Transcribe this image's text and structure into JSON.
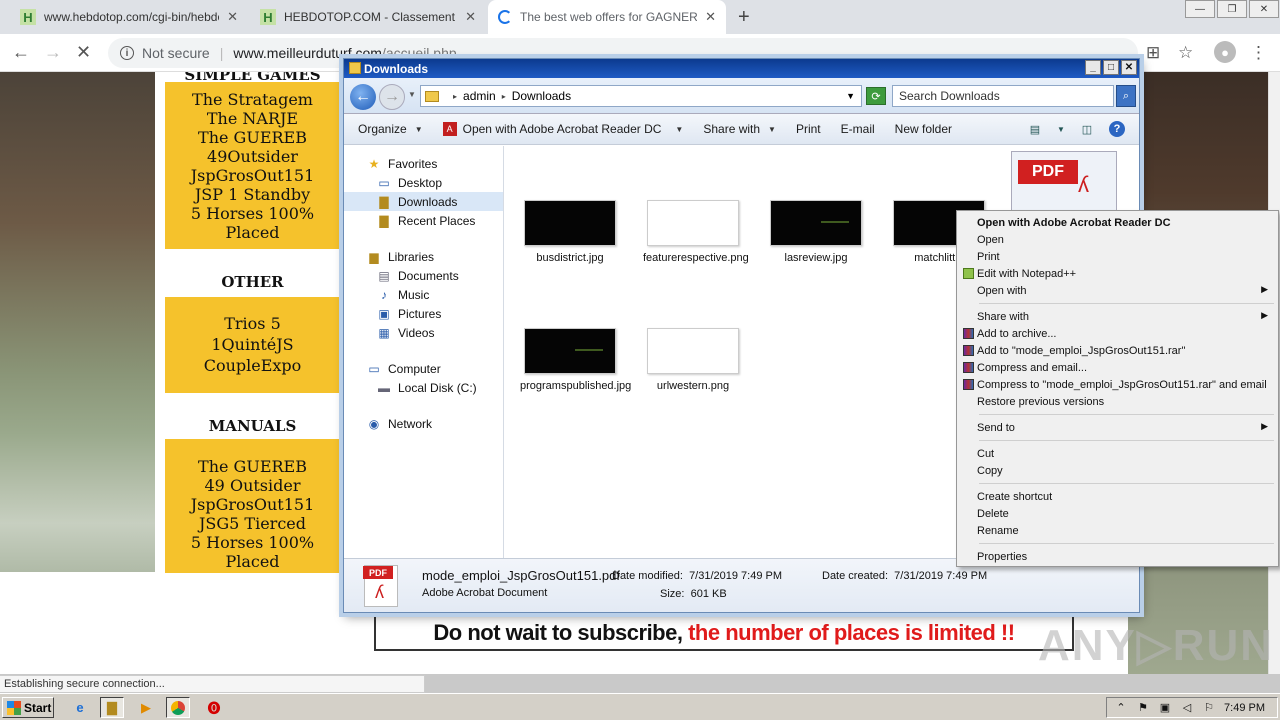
{
  "browser": {
    "tabs": [
      {
        "title": "www.hebdotop.com/cgi-bin/hebdot",
        "favicon": "hebdotop-icon",
        "active": false
      },
      {
        "title": "HEBDOTOP.COM - Classement de sit",
        "favicon": "hebdotop-icon",
        "active": false
      },
      {
        "title": "The best web offers for GAGNER AU",
        "favicon": "loading-spinner-icon",
        "active": true
      }
    ],
    "favicon_letter": "H",
    "new_tab": "+",
    "close_glyph": "✕",
    "window_controls": [
      "—",
      "❐",
      "✕"
    ],
    "address": {
      "security": "Not secure",
      "host": "www.meilleurduturf.com",
      "path": "/accueil.php"
    },
    "status": "Establishing secure connection..."
  },
  "page": {
    "sections": [
      {
        "heading": "SIMPLE GAMES",
        "items": [
          "The Stratagem",
          "The NARJE",
          "The GUEREB",
          "49Outsider",
          "JspGrosOut151",
          "JSP 1 Standby",
          "5 Horses 100% Placed"
        ]
      },
      {
        "heading": "OTHER",
        "items": [
          "Trios 5",
          "1QuintéJS",
          "CoupleExpo"
        ]
      },
      {
        "heading": "MANUALS",
        "items": [
          "The GUEREB",
          "49 Outsider",
          "JspGrosOut151",
          "JSG5 Tierced",
          "5 Horses 100% Placed"
        ]
      }
    ],
    "subscribe": {
      "part1": "Do not wait to subscribe, ",
      "part2": "the number of places is limited !!"
    },
    "watermark": "ANY▷RUN",
    "colors": {
      "accent_box": "#f5c22c",
      "limited_red": "#e01b1b"
    }
  },
  "explorer": {
    "title": "Downloads",
    "title_controls": [
      "_",
      "□",
      "✕"
    ],
    "breadcrumb": [
      "admin",
      "Downloads"
    ],
    "search_placeholder": "Search Downloads",
    "commands": {
      "organize": "Organize",
      "open_with": "Open with Adobe Acrobat Reader DC",
      "share_with": "Share with",
      "print": "Print",
      "email": "E-mail",
      "new_folder": "New folder"
    },
    "tree": {
      "favorites": "Favorites",
      "desktop": "Desktop",
      "downloads": "Downloads",
      "recent": "Recent Places",
      "libraries": "Libraries",
      "documents": "Documents",
      "music": "Music",
      "pictures": "Pictures",
      "videos": "Videos",
      "computer": "Computer",
      "local_disk": "Local Disk (C:)",
      "network": "Network"
    },
    "files": [
      {
        "name": "busdistrict.jpg",
        "thumb": "dark"
      },
      {
        "name": "featurerespective.png",
        "thumb": "light"
      },
      {
        "name": "lasreview.jpg",
        "thumb": "darkdot"
      },
      {
        "name": "matchlittle",
        "thumb": "dark"
      },
      {
        "name": "programspublished.jpg",
        "thumb": "darkdot"
      },
      {
        "name": "urlwestern.png",
        "thumb": "light"
      }
    ],
    "pdf_thumb_label": "PDF",
    "details": {
      "name": "mode_emploi_JspGrosOut151.pdf",
      "type": "Adobe Acrobat Document",
      "modified_label": "Date modified:",
      "modified": "7/31/2019 7:49 PM",
      "created_label": "Date created:",
      "created": "7/31/2019 7:49 PM",
      "size_label": "Size:",
      "size": "601 KB"
    }
  },
  "context_menu": {
    "open_acrobat": "Open with Adobe Acrobat Reader DC",
    "open": "Open",
    "print": "Print",
    "notepad": "Edit with Notepad++",
    "open_with": "Open with",
    "share_with": "Share with",
    "add_archive": "Add to archive...",
    "add_rar": "Add to \"mode_emploi_JspGrosOut151.rar\"",
    "compress_email": "Compress and email...",
    "compress_rar_email": "Compress to \"mode_emploi_JspGrosOut151.rar\" and email",
    "restore": "Restore previous versions",
    "send_to": "Send to",
    "cut": "Cut",
    "copy": "Copy",
    "create_shortcut": "Create shortcut",
    "delete": "Delete",
    "rename": "Rename",
    "properties": "Properties"
  },
  "taskbar": {
    "start": "Start",
    "clock": "7:49 PM"
  }
}
